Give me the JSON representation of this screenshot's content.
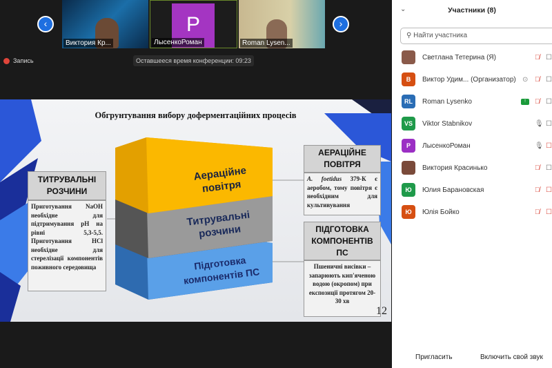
{
  "video_strip": {
    "tiles": [
      {
        "name": "Виктория Кр..."
      },
      {
        "name": "ЛысенкоРоман",
        "initial": "P"
      },
      {
        "name": "Roman Lysen..."
      }
    ],
    "prev_icon": "chevron-left-icon",
    "next_icon": "chevron-right-icon"
  },
  "recording_label": "Запись",
  "timer": "Оставшееся время конференции: 09:23",
  "slide": {
    "title": "Обгрунтування вибору доферментаційних процесів",
    "blocks": [
      {
        "l1": "Аераційне",
        "l2": "повітря",
        "color": "#f5b400"
      },
      {
        "l1": "Титрувальні",
        "l2": "розчини",
        "color": "#8c8c8c"
      },
      {
        "l1": "Підготовка",
        "l2": "компонентів ПС",
        "color": "#4a8fd8"
      }
    ],
    "left_header": "ТИТРУВАЛЬНІ РОЗЧИНИ",
    "left_text": "Приготування NaOH необхідне для підтримування pH на рівні 5,3-5,5. Приготування HCl необхідне для стерелізації компонентів поживного середовища",
    "right_top_header": "АЕРАЦІЙНЕ ПОВІТРЯ",
    "right_top_text_italic": "A. foetidus",
    "right_top_text": " 379-К є аеробом, тому повітря є необхідним для культивування",
    "right_bottom_header": "ПІДГОТОВКА КОМПОНЕНТІВ ПС",
    "right_bottom_text": "Пшеничні висівки – запарюють кип'яченою водою (окропом) при експозиції протягом 20-30 хв",
    "page_number": "12"
  },
  "participants": {
    "title": "Участники (8)",
    "search_placeholder": "Найти участника",
    "list": [
      {
        "name": "Светлана Тетерина (Я)",
        "initials": "",
        "color": "#8a5a4a",
        "mic": "muted",
        "video": "on"
      },
      {
        "name": "Виктор Удим...  (Организатор)",
        "initials": "B",
        "color": "#d64f12",
        "mic": "muted",
        "video": "on"
      },
      {
        "name": "Roman Lysenko",
        "initials": "RL",
        "color": "#2a6db5",
        "mic": "muted",
        "video": "on"
      },
      {
        "name": "Viktor Stabnikov",
        "initials": "VS",
        "color": "#1f9a4a",
        "mic": "on",
        "video": "on"
      },
      {
        "name": "ЛысенкоРоман",
        "initials": "P",
        "color": "#9b2fc4",
        "mic": "on",
        "video": "off"
      },
      {
        "name": "Виктория Красинько",
        "initials": "",
        "color": "#7a4a3a",
        "mic": "muted",
        "video": "on"
      },
      {
        "name": "Юлия Барановская",
        "initials": "Ю",
        "color": "#1f9a4a",
        "mic": "muted",
        "video": "off"
      },
      {
        "name": "Юлія Бойко",
        "initials": "Ю",
        "color": "#d64f12",
        "mic": "muted",
        "video": "off"
      }
    ],
    "invite_label": "Пригласить",
    "unmute_label": "Включить свой звук"
  }
}
